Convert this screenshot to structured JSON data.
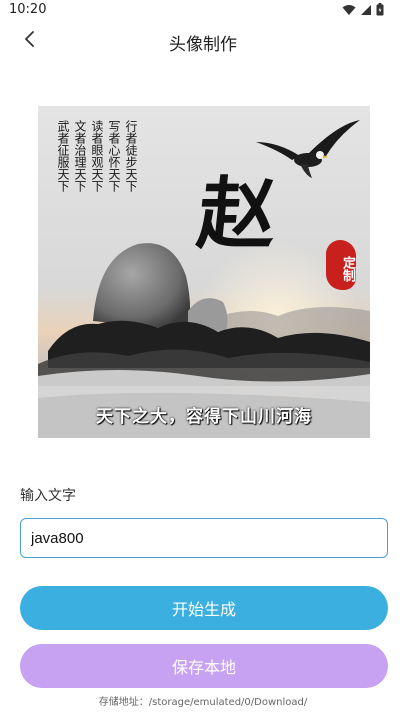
{
  "status_bar": {
    "time": "10:20",
    "icons": [
      "wifi-icon",
      "signal-icon",
      "battery-icon"
    ]
  },
  "header": {
    "title": "头像制作",
    "back_icon": "chevron-left-icon"
  },
  "preview": {
    "poem_columns": [
      "武者征服天下",
      "文者治理天下",
      "读者眼观天下",
      "写者心怀天下",
      "行者徒步天下"
    ],
    "surname": "赵",
    "stamp": "定制",
    "slogan": "天下之大，容得下山川河海"
  },
  "form": {
    "label": "输入文字",
    "input_value": "java800"
  },
  "buttons": {
    "generate": "开始生成",
    "save": "保存本地"
  },
  "footer": {
    "save_path": "存储地址：/storage/emulated/0/Download/"
  },
  "colors": {
    "generate_button": "#3aafe0",
    "save_button": "#c8a2f2",
    "input_border": "#4a9fd1",
    "stamp": "#c8201c"
  }
}
